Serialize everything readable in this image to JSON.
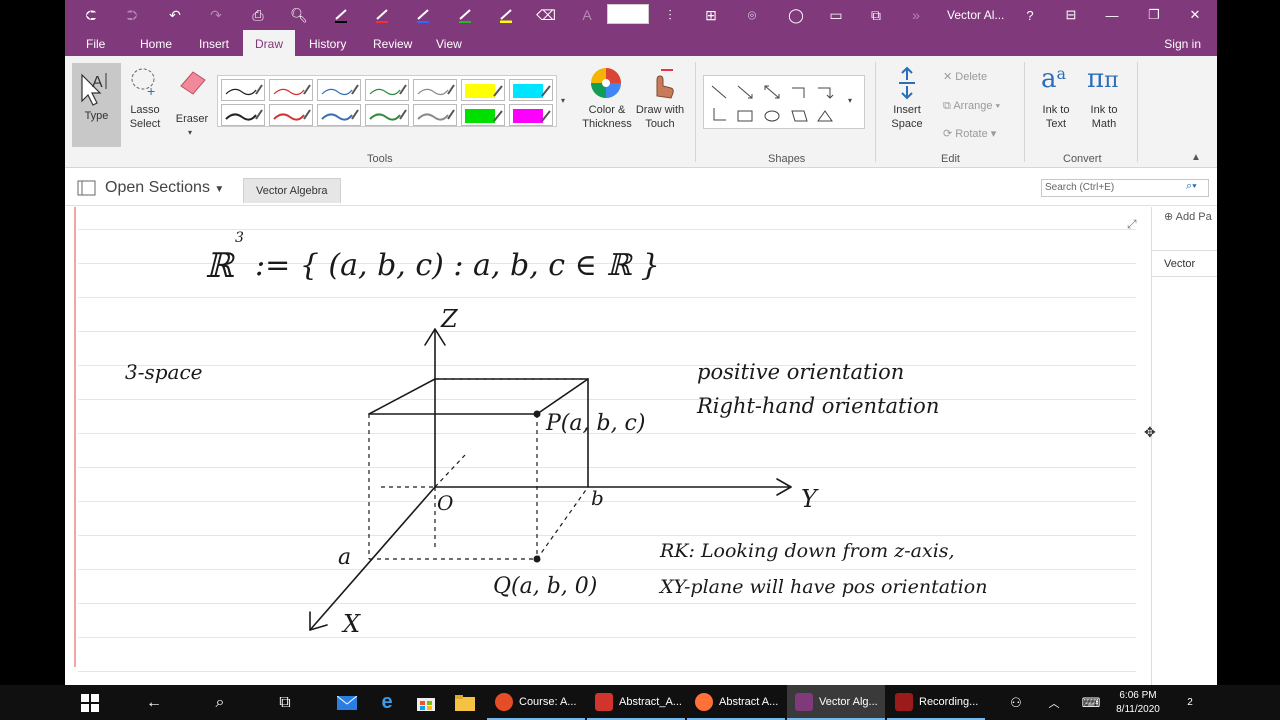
{
  "titlebar": {
    "title": "Vector Al...",
    "help": "?",
    "font_placeholder": "A"
  },
  "menu": {
    "items": [
      "File",
      "Home",
      "Insert",
      "Draw",
      "History",
      "Review",
      "View"
    ],
    "active": "Draw",
    "signin": "Sign in"
  },
  "ribbon": {
    "type_label": "Type",
    "lasso_label_1": "Lasso",
    "lasso_label_2": "Select",
    "eraser_label": "Eraser",
    "color_label_1": "Color &",
    "color_label_2": "Thickness",
    "drawtouch_label_1": "Draw with",
    "drawtouch_label_2": "Touch",
    "insert_space_1": "Insert",
    "insert_space_2": "Space",
    "delete_label": "Delete",
    "arrange_label": "Arrange",
    "rotate_label": "Rotate",
    "ink_text_1": "Ink to",
    "ink_text_2": "Text",
    "ink_math_1": "Ink to",
    "ink_math_2": "Math",
    "groups": {
      "tools": "Tools",
      "shapes": "Shapes",
      "edit": "Edit",
      "convert": "Convert"
    },
    "pen_colors_top": [
      "#222222",
      "#d93030",
      "#3a6fb5",
      "#2e8b3a",
      "#8a8a8a",
      "#ffff00",
      "#00e5ff"
    ],
    "pen_colors_bottom": [
      "#222222",
      "#d93030",
      "#3a6fb5",
      "#2e8b3a",
      "#8a8a8a",
      "#00e000",
      "#ff00ff"
    ]
  },
  "notebook": {
    "open_sections": "Open Sections",
    "section_tab": "Vector Algebra",
    "search_placeholder": "Search (Ctrl+E)",
    "add_page": "Add Pa",
    "page_entry": "Vector"
  },
  "note": {
    "set_def_R": "ℝ",
    "set_def_exp": "3",
    "set_def_rest": ":= { (a, b, c) : a, b, c ∈ ℝ }",
    "margin_note": "3-space",
    "axis_z": "Z",
    "axis_y": "Y",
    "axis_x": "X",
    "origin": "O",
    "label_a": "a",
    "label_b": "b",
    "point_p": "P(a, b, c)",
    "point_q": "Q(a, b, 0)",
    "orient_1": "positive orientation",
    "orient_2": "Right-hand orientation",
    "remark_1": "RK: Looking down from z-axis,",
    "remark_2": "XY-plane will have pos orientation",
    "margin_color": "#e8902a"
  },
  "taskbar": {
    "apps": [
      {
        "label": "Course: A...",
        "color": "#e44d26"
      },
      {
        "label": "Abstract_A...",
        "color": "#d0342c"
      },
      {
        "label": "Abstract A...",
        "color": "#ff7139"
      },
      {
        "label": "Vector Alg...",
        "color": "#80397b"
      },
      {
        "label": "Recording...",
        "color": "#9b1b1b"
      }
    ],
    "time": "6:06 PM",
    "date": "8/11/2020",
    "notification_count": "2"
  }
}
